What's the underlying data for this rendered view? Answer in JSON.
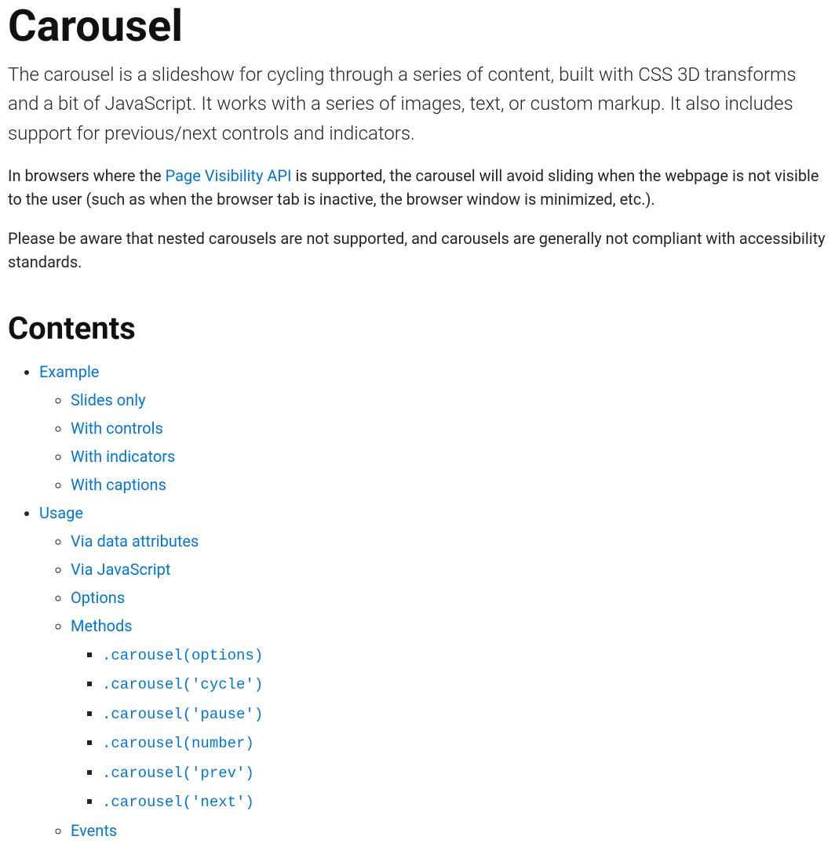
{
  "title": "Carousel",
  "lead": "The carousel is a slideshow for cycling through a series of content, built with CSS 3D transforms and a bit of JavaScript. It works with a series of images, text, or custom markup. It also includes support for previous/next controls and indicators.",
  "para1_pre": "In browsers where the ",
  "para1_link": "Page Visibility API",
  "para1_post": " is supported, the carousel will avoid sliding when the webpage is not visible to the user (such as when the browser tab is inactive, the browser window is minimized, etc.).",
  "para2": "Please be aware that nested carousels are not supported, and carousels are generally not compliant with accessibility standards.",
  "contents_heading": "Contents",
  "toc": {
    "example": {
      "label": "Example",
      "items": [
        "Slides only",
        "With controls",
        "With indicators",
        "With captions"
      ]
    },
    "usage": {
      "label": "Usage",
      "items": {
        "via_data": "Via data attributes",
        "via_js": "Via JavaScript",
        "options": "Options",
        "methods": {
          "label": "Methods",
          "items": [
            ".carousel(options)",
            ".carousel('cycle')",
            ".carousel('pause')",
            ".carousel(number)",
            ".carousel('prev')",
            ".carousel('next')"
          ]
        },
        "events": "Events"
      }
    }
  }
}
